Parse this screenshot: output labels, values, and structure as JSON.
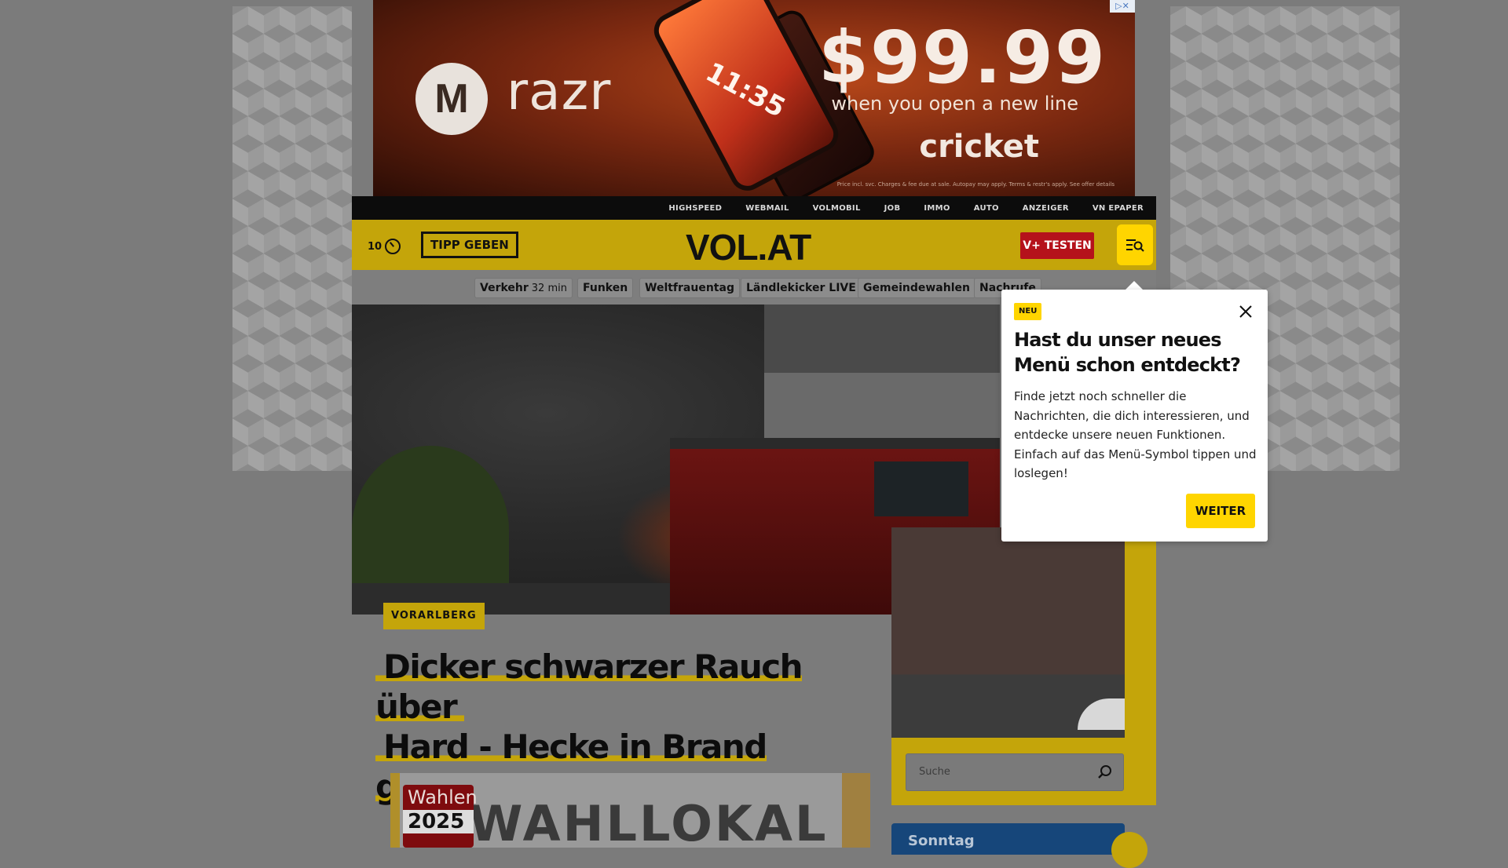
{
  "ad": {
    "brand": "razr",
    "logo_letter": "M",
    "phone_time": "11:35",
    "price": "$99.99",
    "subline": "when you open a new line",
    "carrier": "cricket",
    "fineprint": "Price incl. svc. Charges & fee due at sale. Autopay may apply. Terms & restr's apply. See offer details",
    "adchoice": "▷✕"
  },
  "topbar": {
    "links": [
      "HIGHSPEED",
      "WEBMAIL",
      "VOLMOBIL",
      "JOB",
      "IMMO",
      "AUTO",
      "ANZEIGER",
      "VN EPAPER"
    ]
  },
  "header": {
    "count": "10",
    "tip_label": "TIPP GEBEN",
    "logo": "VOL.AT",
    "vplus_label": "V+ TESTEN"
  },
  "quicklinks": [
    {
      "label": "Verkehr",
      "sub": "32 min"
    },
    {
      "label": "Funken",
      "sub": ""
    },
    {
      "label": "Weltfrauentag",
      "sub": ""
    },
    {
      "label": "Ländlekicker LIVE",
      "sub": ""
    },
    {
      "label": "Gemeindewahlen",
      "sub": ""
    },
    {
      "label": "Nachrufe",
      "sub": ""
    }
  ],
  "article": {
    "category": "VORARLBERG",
    "headline_line1": "Dicker schwarzer Rauch über",
    "headline_line2": "Hard - Hecke in Brand geraten"
  },
  "teaser": {
    "badge_word": "Wahlen",
    "badge_year": "2025",
    "big_text": "WAHLLOKAL"
  },
  "search": {
    "placeholder": "Suche"
  },
  "sidebar": {
    "sunday_label": "Sonntag"
  },
  "popup": {
    "badge": "NEU",
    "title": "Hast du unser neues Menü schon entdeckt?",
    "body": "Finde jetzt noch schneller die Nachrichten, die dich interessieren, und entdecke unsere neuen Funktionen. Einfach auf das Menü-Symbol tippen und loslegen!",
    "button": "WEITER"
  },
  "colors": {
    "brand_yellow": "#ffd500",
    "dimmed_yellow": "#c4a50a",
    "vplus_red": "#b5121b",
    "topbar_black": "#0c0c0c"
  }
}
